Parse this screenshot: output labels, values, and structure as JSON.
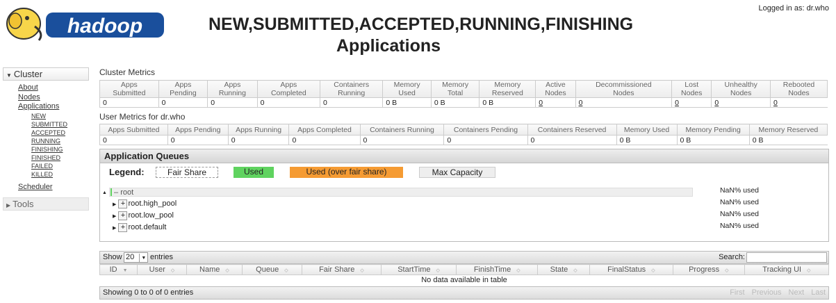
{
  "header": {
    "logged_in": "Logged in as: dr.who",
    "title_line1": "NEW,SUBMITTED,ACCEPTED,RUNNING,FINISHING",
    "title_line2": "Applications"
  },
  "sidebar": {
    "cluster_label": "Cluster",
    "links": [
      "About",
      "Nodes",
      "Applications"
    ],
    "app_states": [
      "NEW",
      "SUBMITTED",
      "ACCEPTED",
      "RUNNING",
      "FINISHING",
      "FINISHED",
      "FAILED",
      "KILLED"
    ],
    "scheduler": "Scheduler",
    "tools_label": "Tools"
  },
  "cluster_metrics": {
    "label": "Cluster Metrics",
    "headers": [
      [
        "Apps",
        "Submitted"
      ],
      [
        "Apps",
        "Pending"
      ],
      [
        "Apps",
        "Running"
      ],
      [
        "Apps",
        "Completed"
      ],
      [
        "Containers",
        "Running"
      ],
      [
        "Memory",
        "Used"
      ],
      [
        "Memory",
        "Total"
      ],
      [
        "Memory",
        "Reserved"
      ],
      [
        "Active",
        "Nodes"
      ],
      [
        "Decommissioned",
        "Nodes"
      ],
      [
        "Lost",
        "Nodes"
      ],
      [
        "Unhealthy",
        "Nodes"
      ],
      [
        "Rebooted",
        "Nodes"
      ]
    ],
    "values": [
      "0",
      "0",
      "0",
      "0",
      "0",
      "0 B",
      "0 B",
      "0 B",
      "0",
      "0",
      "0",
      "0",
      "0"
    ]
  },
  "user_metrics": {
    "label": "User Metrics for dr.who",
    "headers": [
      "Apps Submitted",
      "Apps Pending",
      "Apps Running",
      "Apps Completed",
      "Containers Running",
      "Containers Pending",
      "Containers Reserved",
      "Memory Used",
      "Memory Pending",
      "Memory Reserved"
    ],
    "values": [
      "0",
      "0",
      "0",
      "0",
      "0",
      "0",
      "0",
      "0 B",
      "0 B",
      "0 B"
    ]
  },
  "queues": {
    "title": "Application Queues",
    "legend_label": "Legend:",
    "legend": [
      "Fair Share",
      "Used",
      "Used (over fair share)",
      "Max Capacity"
    ],
    "colors": {
      "used": "#5fd35f",
      "over": "#f59b33",
      "max": "#eeeeee"
    },
    "root": {
      "name": "root",
      "used": "NaN% used"
    },
    "children": [
      {
        "name": "root.high_pool",
        "used": "NaN% used"
      },
      {
        "name": "root.low_pool",
        "used": "NaN% used"
      },
      {
        "name": "root.default",
        "used": "NaN% used"
      }
    ]
  },
  "apps": {
    "show_label": "Show",
    "page_size": "20",
    "entries_label": "entries",
    "search_label": "Search:",
    "columns": [
      "ID",
      "User",
      "Name",
      "Queue",
      "Fair Share",
      "StartTime",
      "FinishTime",
      "State",
      "FinalStatus",
      "Progress",
      "Tracking UI"
    ],
    "empty": "No data available in table",
    "showing": "Showing 0 to 0 of 0 entries",
    "pager": [
      "First",
      "Previous",
      "Next",
      "Last"
    ]
  }
}
